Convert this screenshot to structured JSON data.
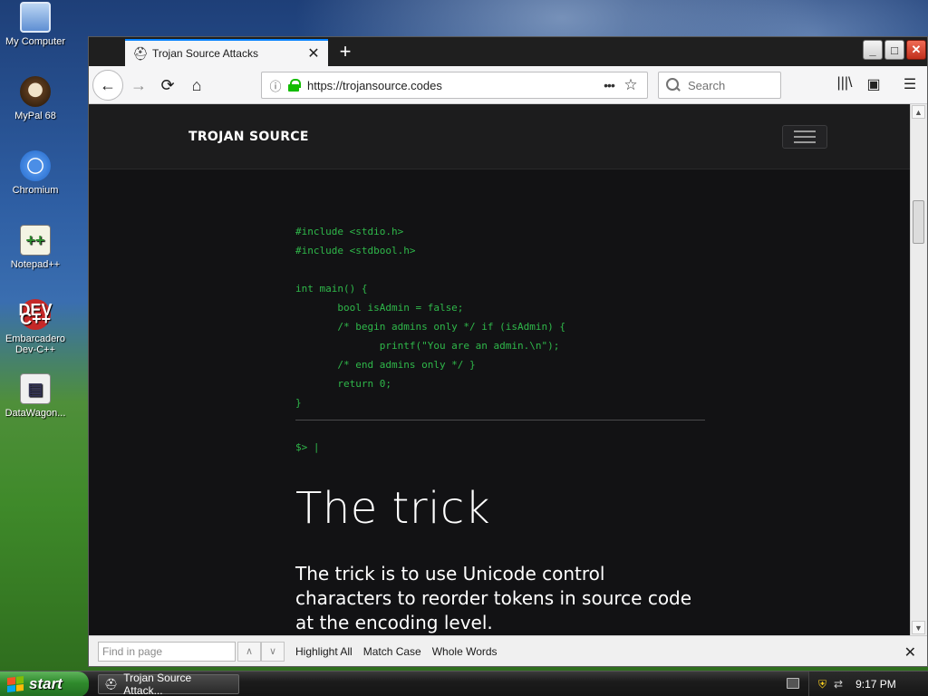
{
  "desktop": {
    "icons": [
      {
        "label": "My Computer",
        "glyph": "▭"
      },
      {
        "label": "MyPal 68",
        "glyph": ""
      },
      {
        "label": "Chromium",
        "glyph": ""
      },
      {
        "label": "Notepad++",
        "glyph": "++"
      },
      {
        "label": "Embarcadero Dev-C++",
        "glyph": "DEV C++"
      },
      {
        "label": "DataWagon...",
        "glyph": "▤"
      }
    ]
  },
  "browser": {
    "tab": {
      "title": "Trojan Source Attacks",
      "favicon": "spartan-helmet-icon"
    },
    "url": "https://trojansource.codes",
    "search_placeholder": "Search",
    "icons": {
      "back": "←",
      "forward": "→",
      "reload": "⟳",
      "home": "⌂",
      "info": "ⓘ",
      "page_actions": "•••",
      "star": "☆",
      "library": "|||\\",
      "sidebar": "▣",
      "menu": "☰",
      "new_tab": "+",
      "close_tab": "✕",
      "minimize": "_",
      "maximize": "□",
      "close_window": "✕"
    }
  },
  "page": {
    "brand": "TROJAN SOURCE",
    "code_lines": [
      "#include <stdio.h>",
      "#include <stdbool.h>",
      "",
      "int main() {",
      "       bool isAdmin = false;",
      "       /* begin admins only */ if (isAdmin) {",
      "              printf(\"You are an admin.\\n\");",
      "       /* end admins only */ }",
      "       return 0;",
      "}"
    ],
    "prompt": "$> |",
    "heading": "The trick",
    "paragraph": "The trick is to use Unicode control characters to reorder tokens in source code at the encoding level."
  },
  "findbar": {
    "placeholder": "Find in page",
    "prev": "∧",
    "next": "∨",
    "highlight_all": "Highlight All",
    "match_case": "Match Case",
    "whole_words": "Whole Words",
    "close": "✕"
  },
  "taskbar": {
    "start_label": "start",
    "task_label": "Trojan Source Attack...",
    "clock": "9:17 PM"
  },
  "colors": {
    "code_green": "#2fb84a",
    "page_bg": "#121214",
    "start_green": "#2f8a2c"
  }
}
